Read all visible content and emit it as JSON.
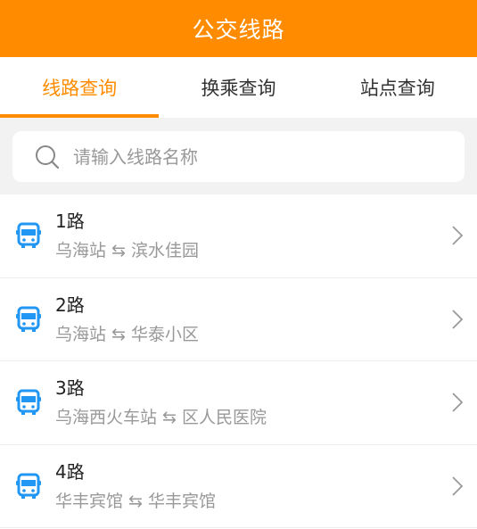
{
  "header": {
    "title": "公交线路"
  },
  "tabs": [
    {
      "label": "线路查询",
      "active": true
    },
    {
      "label": "换乘查询",
      "active": false
    },
    {
      "label": "站点查询",
      "active": false
    }
  ],
  "search": {
    "placeholder": "请输入线路名称",
    "value": ""
  },
  "routes": [
    {
      "name": "1路",
      "from": "乌海站",
      "arrow": "⇆",
      "to": "滨水佳园"
    },
    {
      "name": "2路",
      "from": "乌海站",
      "arrow": "⇆",
      "to": "华泰小区"
    },
    {
      "name": "3路",
      "from": "乌海西火车站",
      "arrow": "⇆",
      "to": "区人民医院"
    },
    {
      "name": "4路",
      "from": "华丰宾馆",
      "arrow": "⇆",
      "to": "华丰宾馆"
    }
  ],
  "colors": {
    "accent": "#ff8c00",
    "bus_icon": "#2196f3",
    "secondary_text": "#999999"
  },
  "icons": {
    "search": "search-icon",
    "bus": "bus-icon",
    "chevron": "chevron-right-icon"
  }
}
